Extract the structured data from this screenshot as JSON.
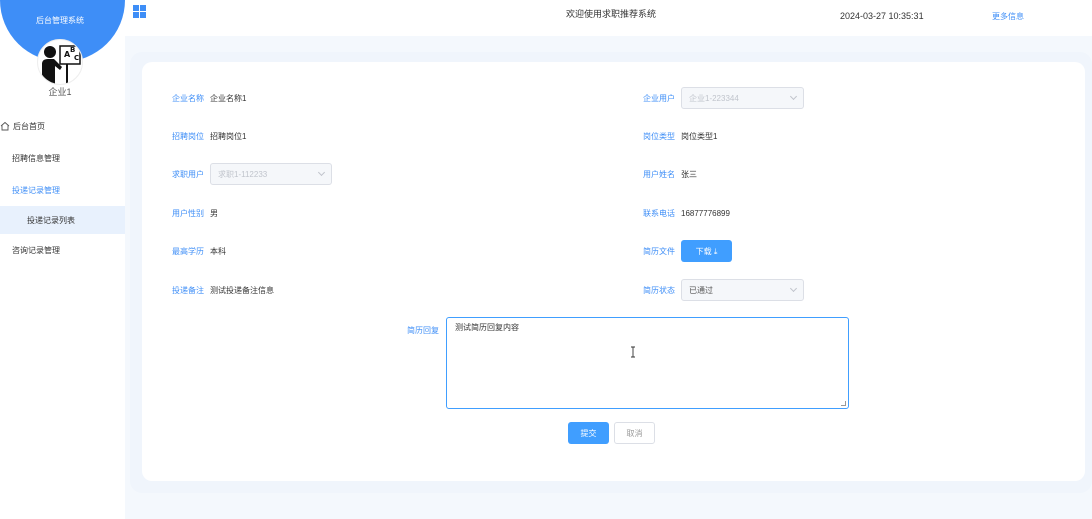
{
  "sidebar": {
    "system_title": "后台管理系统",
    "company_name": "企业1",
    "menu": [
      {
        "label": "后台首页"
      },
      {
        "label": "招聘信息管理"
      },
      {
        "label": "投递记录管理"
      },
      {
        "label": "投递记录列表"
      },
      {
        "label": "咨询记录管理"
      }
    ]
  },
  "topbar": {
    "welcome": "欢迎使用求职推荐系统",
    "datetime": "2024-03-27 10:35:31",
    "more_info": "更多信息"
  },
  "form": {
    "company_name": {
      "label": "企业名称",
      "value": "企业名称1"
    },
    "company_user": {
      "label": "企业用户",
      "value": "企业1-223344"
    },
    "position": {
      "label": "招聘岗位",
      "value": "招聘岗位1"
    },
    "position_type": {
      "label": "岗位类型",
      "value": "岗位类型1"
    },
    "job_seeker": {
      "label": "求职用户",
      "value": "求职1-112233"
    },
    "user_name": {
      "label": "用户姓名",
      "value": "张三"
    },
    "gender": {
      "label": "用户性别",
      "value": "男"
    },
    "phone": {
      "label": "联系电话",
      "value": "16877776899"
    },
    "education": {
      "label": "最高学历",
      "value": "本科"
    },
    "resume_file": {
      "label": "简历文件",
      "button": "下载 ⤓"
    },
    "remark": {
      "label": "投递备注",
      "value": "测试投递备注信息"
    },
    "resume_status": {
      "label": "简历状态",
      "value": "已通过"
    },
    "reply": {
      "label": "简历回复",
      "value": "测试简历回复内容"
    }
  },
  "actions": {
    "submit": "提交",
    "cancel": "取消"
  },
  "colors": {
    "accent": "#409eff",
    "sidebar_head": "#3e8ef7"
  }
}
